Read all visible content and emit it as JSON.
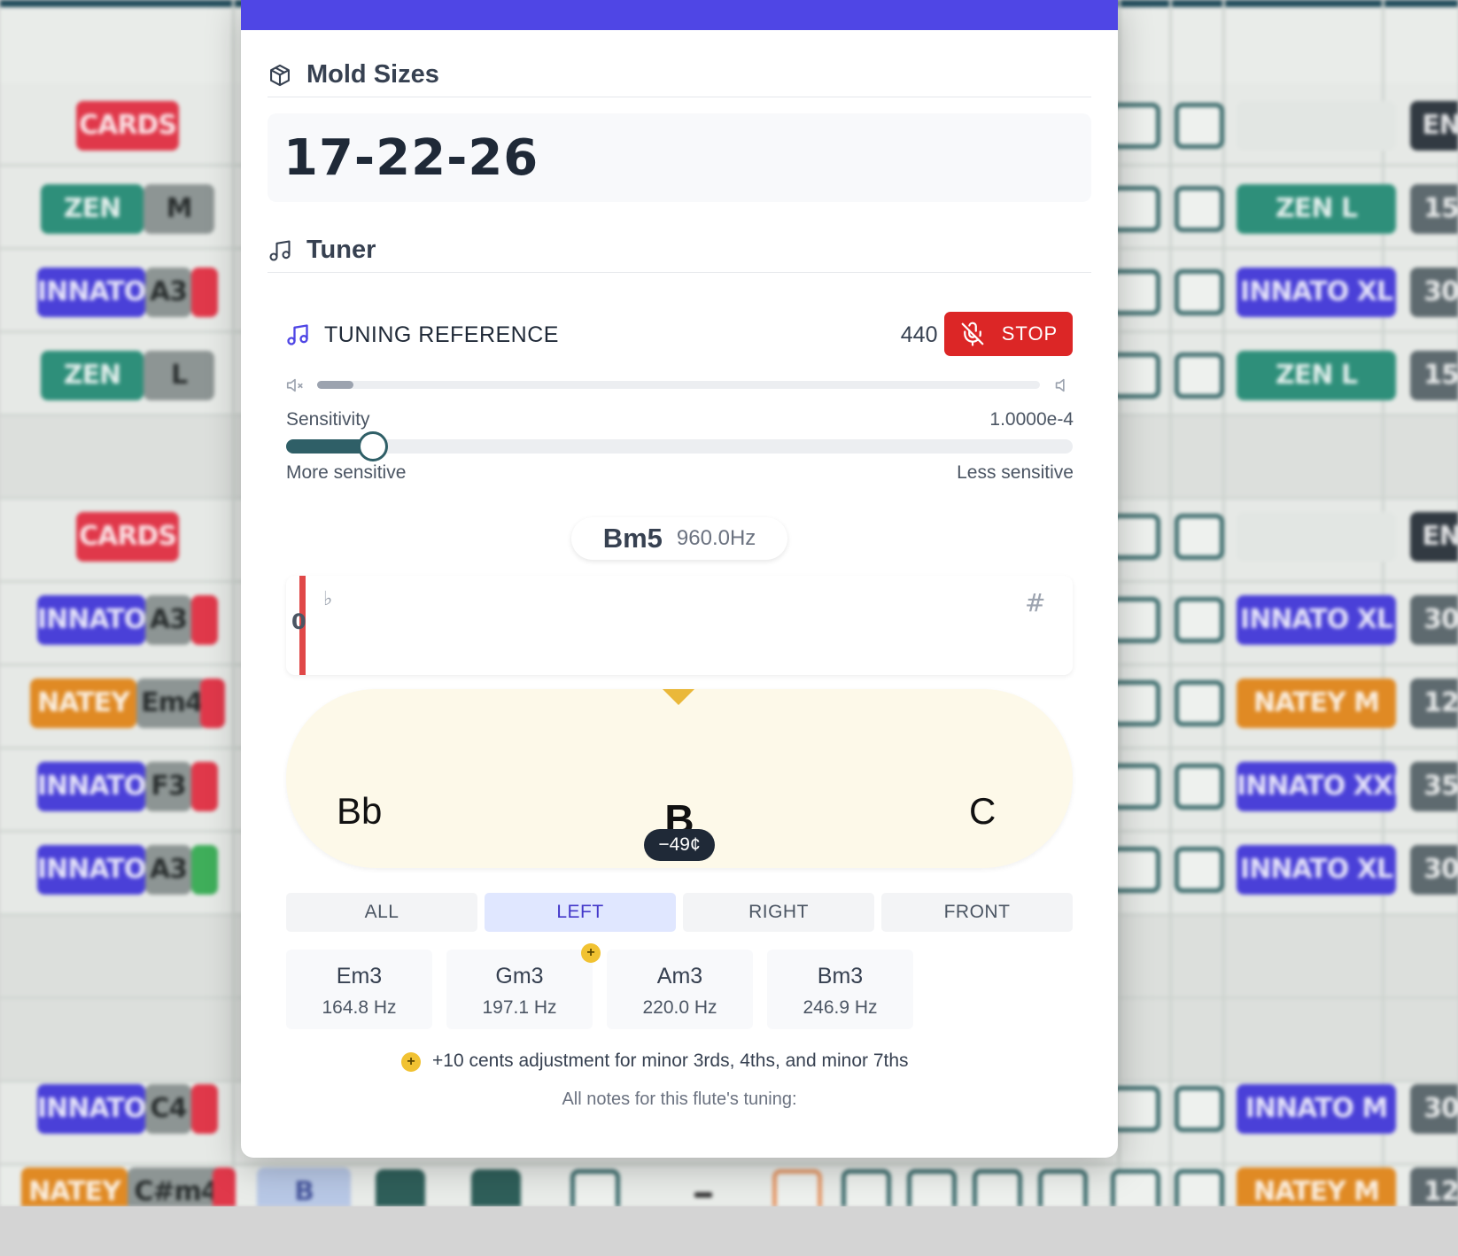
{
  "background": {
    "left_rows": [
      {
        "chips": [
          {
            "text": "CARDS",
            "color": "red"
          }
        ]
      },
      {
        "chips": [
          {
            "text": "ZEN",
            "color": "teal"
          },
          {
            "text": "M",
            "color": "grey"
          }
        ]
      },
      {
        "chips": [
          {
            "text": "INNATO",
            "color": "purple"
          },
          {
            "text": "A3",
            "color": "grey"
          },
          {
            "text": "",
            "color": "red"
          }
        ]
      },
      {
        "chips": [
          {
            "text": "ZEN",
            "color": "teal"
          },
          {
            "text": "L",
            "color": "grey"
          }
        ]
      },
      {
        "chips": [
          {
            "text": "CARDS",
            "color": "red"
          }
        ]
      },
      {
        "chips": [
          {
            "text": "INNATO",
            "color": "purple"
          },
          {
            "text": "A3",
            "color": "grey"
          },
          {
            "text": "",
            "color": "red"
          }
        ]
      },
      {
        "chips": [
          {
            "text": "NATEY",
            "color": "orange"
          },
          {
            "text": "Em4",
            "color": "grey"
          },
          {
            "text": "",
            "color": "red"
          }
        ]
      },
      {
        "chips": [
          {
            "text": "INNATO",
            "color": "purple"
          },
          {
            "text": "F3",
            "color": "grey"
          },
          {
            "text": "",
            "color": "red"
          }
        ]
      },
      {
        "chips": [
          {
            "text": "INNATO",
            "color": "purple"
          },
          {
            "text": "A3",
            "color": "grey"
          },
          {
            "text": "",
            "color": "green"
          }
        ]
      },
      {
        "chips": [
          {
            "text": "INNATO",
            "color": "purple"
          },
          {
            "text": "C4",
            "color": "grey"
          },
          {
            "text": "",
            "color": "red"
          }
        ]
      },
      {
        "chips": [
          {
            "text": "NATEY",
            "color": "orange"
          },
          {
            "text": "C#m4",
            "color": "grey"
          },
          {
            "text": "",
            "color": "red"
          }
        ]
      }
    ],
    "right_chips": [
      {
        "text": "EN",
        "color": "dark"
      },
      {
        "text": "ZEN L",
        "color": "teal",
        "side": "15"
      },
      {
        "text": "INNATO XL",
        "color": "purple",
        "side": "30"
      },
      {
        "text": "ZEN L",
        "color": "teal",
        "side": "15"
      },
      {
        "text": "EN",
        "color": "dark"
      },
      {
        "text": "INNATO XL",
        "color": "purple",
        "side": "30"
      },
      {
        "text": "NATEY M",
        "color": "orange",
        "side": "12"
      },
      {
        "text": "INNATO XXL",
        "color": "purple",
        "side": "35"
      },
      {
        "text": "INNATO XL",
        "color": "purple",
        "side": "30"
      },
      {
        "text": "INNATO M",
        "color": "purple",
        "side": "30"
      },
      {
        "text": "NATEY M",
        "color": "orange",
        "side": "12"
      }
    ],
    "bottom_chip": "B"
  },
  "mold_sizes": {
    "title": "Mold Sizes",
    "value": "17-22-26"
  },
  "tuner": {
    "title": "Tuner",
    "reference_label": "TUNING REFERENCE",
    "reference_hz": "440 Hz",
    "stop_label": "STOP",
    "volume_level": 0.05,
    "sensitivity": {
      "label": "Sensitivity",
      "value": "1.0000e-4",
      "position": 0.11,
      "min_label": "More sensitive",
      "max_label": "Less sensitive"
    },
    "detected": {
      "note": "Bm5",
      "hz": "960.0Hz"
    },
    "strobe": {
      "flat_symbol": "♭",
      "sharp_symbol": "#",
      "zero_label": "0"
    },
    "dial": {
      "left_note": "Bb",
      "center_note": "B",
      "right_note": "C",
      "cents": "−49¢"
    }
  },
  "tabs": [
    {
      "label": "ALL",
      "active": false
    },
    {
      "label": "LEFT",
      "active": true
    },
    {
      "label": "RIGHT",
      "active": false
    },
    {
      "label": "FRONT",
      "active": false
    }
  ],
  "note_cards": [
    {
      "note": "Em3",
      "hz": "164.8 Hz",
      "adjusted": false
    },
    {
      "note": "Gm3",
      "hz": "197.1 Hz",
      "adjusted": true
    },
    {
      "note": "Am3",
      "hz": "220.0 Hz",
      "adjusted": false
    },
    {
      "note": "Bm3",
      "hz": "246.9 Hz",
      "adjusted": false
    }
  ],
  "legend": {
    "symbol": "+",
    "text": "+10 cents adjustment for minor 3rds, 4ths, and minor 7ths"
  },
  "all_notes_label": "All notes for this flute's tuning:",
  "colors": {
    "header_bar": "#4f46e5",
    "stop_button": "#dc2626",
    "slider_fill": "#2f5f67",
    "dial_bg": "#fdf9e9",
    "pointer": "#eab83a",
    "plus_dot": "#f1c232"
  }
}
